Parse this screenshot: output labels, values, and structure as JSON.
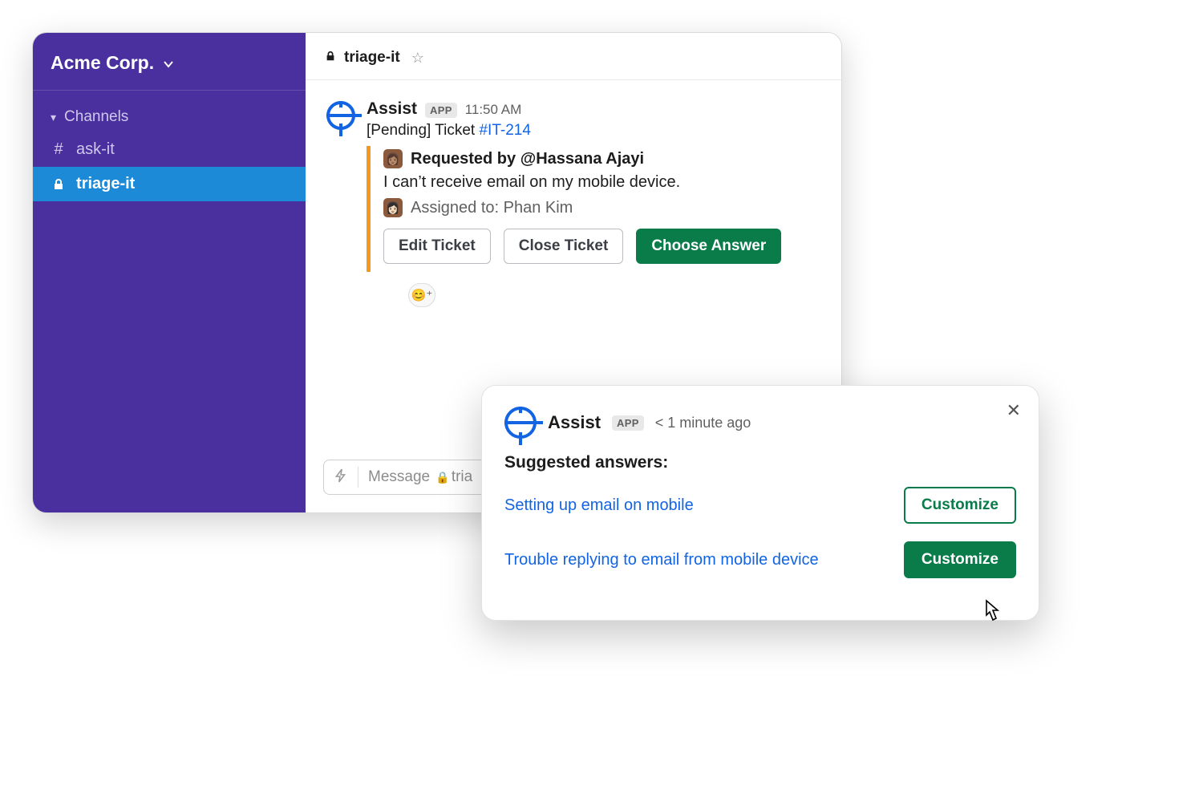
{
  "workspace": {
    "name": "Acme Corp."
  },
  "sidebar": {
    "section_label": "Channels",
    "items": [
      {
        "prefix": "#",
        "label": "ask-it",
        "active": false,
        "locked": false
      },
      {
        "prefix": "lock",
        "label": "triage-it",
        "active": true,
        "locked": true
      }
    ]
  },
  "channel_header": {
    "name": "triage-it",
    "locked": true
  },
  "message": {
    "sender": "Assist",
    "app_badge": "APP",
    "time": "11:50 AM",
    "pending_prefix": "[Pending] Ticket ",
    "ticket_id": "#IT-214",
    "requested_prefix": "Requested by ",
    "requester": "@Hassana Ajayi",
    "issue_text": "I can’t receive email on my mobile device.",
    "assigned_prefix": "Assigned to: ",
    "assignee": "Phan Kim",
    "buttons": {
      "edit": "Edit Ticket",
      "close": "Close Ticket",
      "choose": "Choose Answer"
    }
  },
  "composer": {
    "placeholder_prefix": "Message ",
    "placeholder_channel": "tria"
  },
  "popup": {
    "sender": "Assist",
    "app_badge": "APP",
    "time": "< 1 minute ago",
    "title": "Suggested answers:",
    "answers": [
      {
        "text": "Setting up email on mobile",
        "button": "Customize"
      },
      {
        "text": "Trouble replying to email from mobile device",
        "button": "Customize"
      }
    ]
  }
}
